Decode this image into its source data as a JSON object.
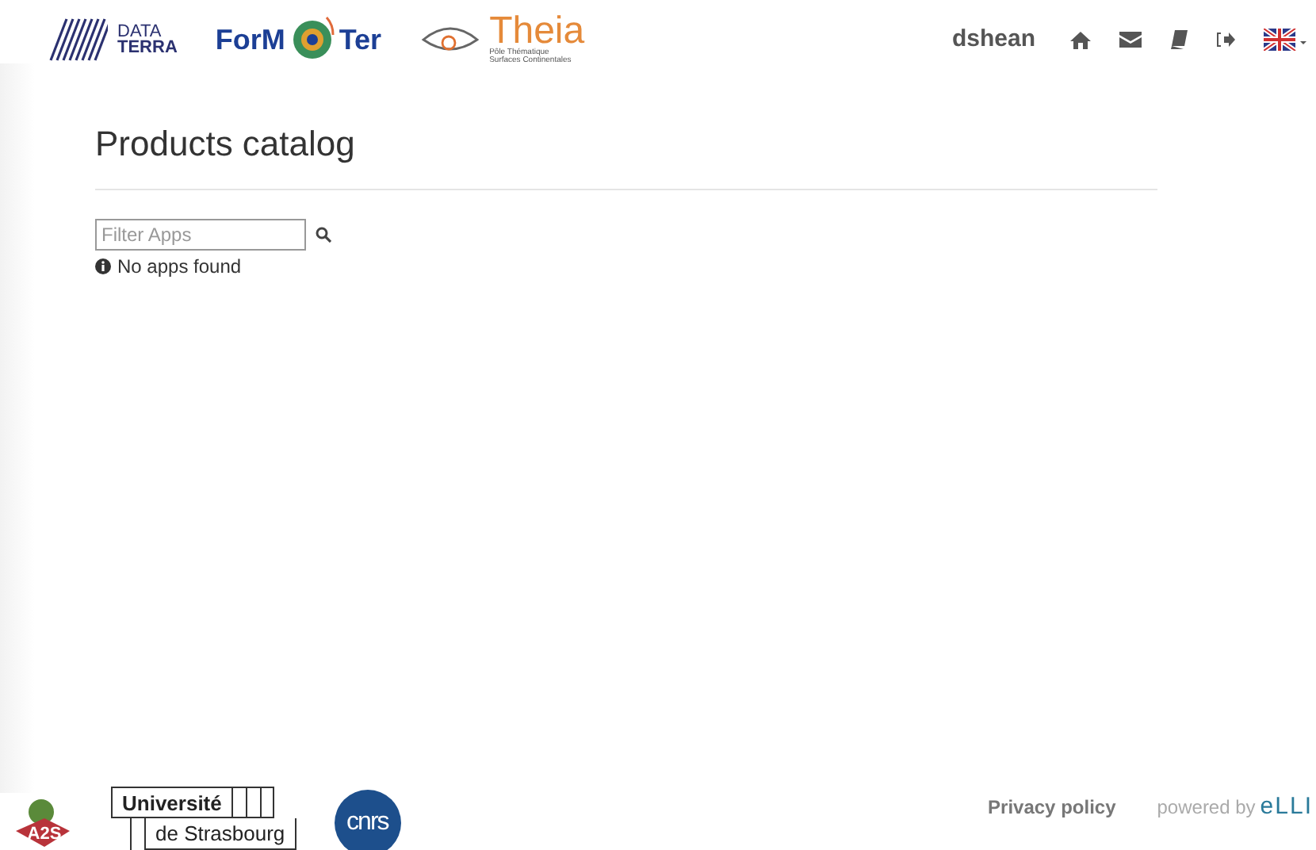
{
  "header": {
    "logos": [
      {
        "kind": "dataterra",
        "line1": "DATA",
        "line2": "TERRA"
      },
      {
        "kind": "formater",
        "left": "ForM",
        "right": "Ter"
      },
      {
        "kind": "theia",
        "name": "Theia",
        "line1": "Pôle Thématique",
        "line2": "Surfaces Continentales"
      }
    ],
    "user": "dshean",
    "nav_icons": [
      {
        "kind": "home"
      },
      {
        "kind": "mail"
      },
      {
        "kind": "book"
      },
      {
        "kind": "logout"
      },
      {
        "kind": "flag"
      }
    ]
  },
  "page": {
    "title": "Products catalog",
    "filter": {
      "placeholder": "Filter Apps"
    },
    "message": "No apps found"
  },
  "footer": {
    "logos": [
      {
        "kind": "a2s",
        "text": "A2S"
      },
      {
        "kind": "unistra",
        "line1": "Université",
        "line2": "de Strasbourg"
      },
      {
        "kind": "cnrs",
        "text": "cnrs"
      }
    ],
    "privacy": "Privacy policy",
    "powered": "powered by",
    "brand": "eLLI"
  }
}
